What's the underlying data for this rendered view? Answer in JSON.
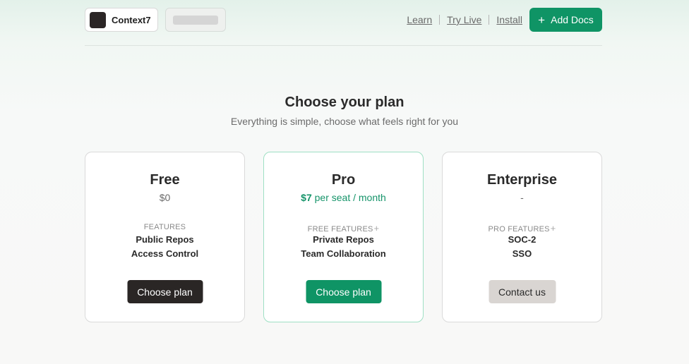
{
  "header": {
    "logo_text": "Context7",
    "nav": [
      {
        "label": "Learn"
      },
      {
        "label": "Try Live"
      },
      {
        "label": "Install"
      }
    ],
    "add_docs_label": "Add Docs"
  },
  "main": {
    "title": "Choose your plan",
    "subtitle": "Everything is simple, choose what feels right for you"
  },
  "plans": [
    {
      "name": "Free",
      "price": "$0",
      "price_amount": "",
      "price_suffix": "",
      "features_label": "FEATURES",
      "features": [
        "Public Repos",
        "Access Control"
      ],
      "button_label": "Choose plan"
    },
    {
      "name": "Pro",
      "price": "",
      "price_amount": "$7",
      "price_suffix": " per seat / month",
      "features_label": "FREE FEATURES",
      "features": [
        "Private Repos",
        "Team Collaboration"
      ],
      "button_label": "Choose plan"
    },
    {
      "name": "Enterprise",
      "price": "-",
      "price_amount": "",
      "price_suffix": "",
      "features_label": "PRO FEATURES",
      "features": [
        "SOC-2",
        "SSO"
      ],
      "button_label": "Contact us"
    }
  ],
  "icons": {
    "add": "plus-icon",
    "features_plus": "plus-icon"
  },
  "colors": {
    "accent": "#0f9465",
    "dark_button": "#2a2625",
    "gray_button": "#d9d5d2",
    "pro_border": "#9fe0c4"
  }
}
